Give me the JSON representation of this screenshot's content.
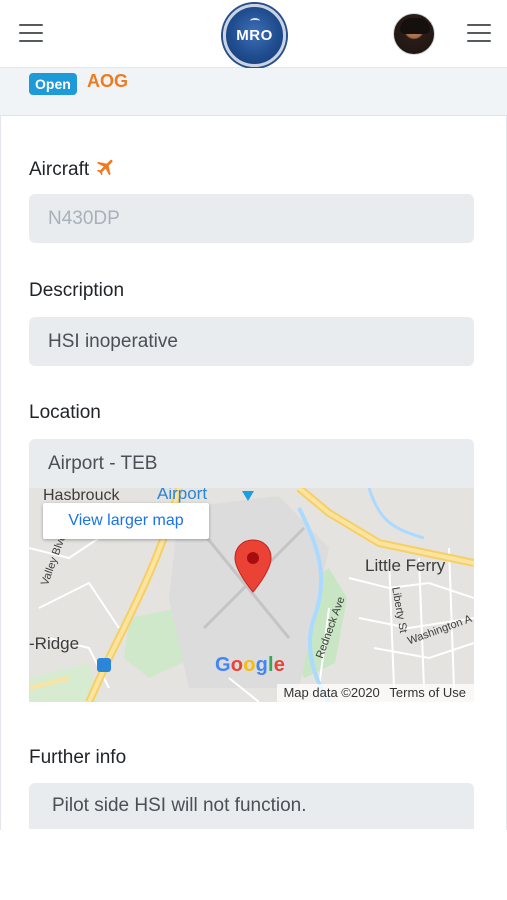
{
  "header": {
    "logo_text": "MRO",
    "menu_left_icon": "hamburger-icon",
    "menu_right_icon": "hamburger-icon",
    "avatar_icon": "user-avatar"
  },
  "status": {
    "badge": "Open",
    "type": "AOG",
    "badge_color": "#1e9ad9",
    "type_color": "#f07a1f"
  },
  "form": {
    "aircraft_label": "Aircraft",
    "aircraft_icon": "airplane-icon",
    "aircraft_placeholder": "N430DP",
    "description_label": "Description",
    "description_value": "HSI inoperative",
    "location_label": "Location",
    "location_value": "Airport - TEB",
    "further_info_label": "Further info",
    "further_info_value": "Pilot side HSI will not function."
  },
  "map": {
    "larger_map_link": "View larger map",
    "places": {
      "hasbrouck": "Hasbrouck",
      "airport": "Airport",
      "little_ferry": "Little Ferry",
      "ridge": "-Ridge",
      "valley_blvd": "Valley Blvd",
      "liberty_st": "Liberty St",
      "washington": "Washington A",
      "redneck_ave": "Redneck Ave"
    },
    "google_logo": "Google",
    "attribution": "Map data ©2020",
    "terms": "Terms of Use",
    "marker_icon": "map-pin-icon",
    "marker_color": "#ea4335"
  }
}
